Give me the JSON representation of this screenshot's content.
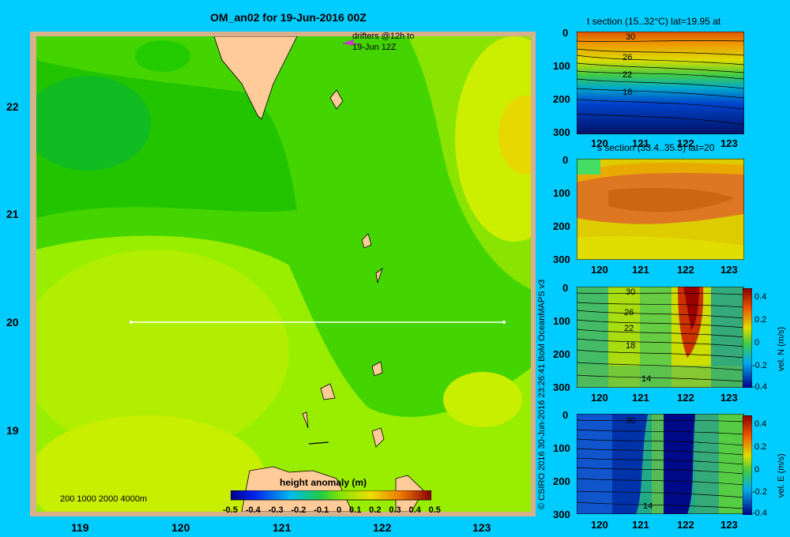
{
  "title": "OM_an02 for 19-Jun-2016 00Z",
  "drifter_note_line1": "drifters @12h to",
  "drifter_note_line2": "19-Jun 12Z",
  "map": {
    "lat_ticks": [
      "22",
      "21",
      "20",
      "19"
    ],
    "lon_ticks": [
      "119",
      "120",
      "121",
      "122",
      "123"
    ],
    "depth_legend": "200  1000  2000  4000m",
    "colorbar_title": "height anomaly  (m)",
    "colorbar_ticks": [
      "-0.5",
      "-0.4",
      "-0.3",
      "-0.2",
      "-0.1",
      "0",
      "0.1",
      "0.2",
      "0.3",
      "0.4",
      "0.5"
    ]
  },
  "credit": "© CSIRO 2016   30-Jun-2016 23:26:41 BoM OceanMAPS v3",
  "panels": [
    {
      "title": "t section (15..32°C) lat=19.95 at",
      "yticks": [
        "0",
        "100",
        "200",
        "300"
      ],
      "xticks": [
        "120",
        "121",
        "122",
        "123"
      ],
      "contour_labels": [
        "30",
        "26",
        "22",
        "18"
      ]
    },
    {
      "title": "s section (33.4..35.5) lat=20",
      "yticks": [
        "0",
        "100",
        "200",
        "300"
      ],
      "xticks": [
        "120",
        "121",
        "122",
        "123"
      ],
      "contour_labels": []
    },
    {
      "title": "",
      "yticks": [
        "0",
        "100",
        "200",
        "300"
      ],
      "xticks": [
        "120",
        "121",
        "122",
        "123"
      ],
      "contour_labels": [
        "30",
        "26",
        "22",
        "18",
        "14"
      ],
      "cbar_label": "vel. N  (m/s)",
      "cbar_ticks": [
        "0.4",
        "0.2",
        "0",
        "-0.2",
        "-0.4"
      ]
    },
    {
      "title": "",
      "yticks": [
        "0",
        "100",
        "200",
        "300"
      ],
      "xticks": [
        "120",
        "121",
        "122",
        "123"
      ],
      "contour_labels": [
        "30",
        "14"
      ],
      "cbar_label": "vel. E  (m/s)",
      "cbar_ticks": [
        "0.4",
        "0.2",
        "0",
        "-0.2",
        "-0.4"
      ]
    }
  ]
}
